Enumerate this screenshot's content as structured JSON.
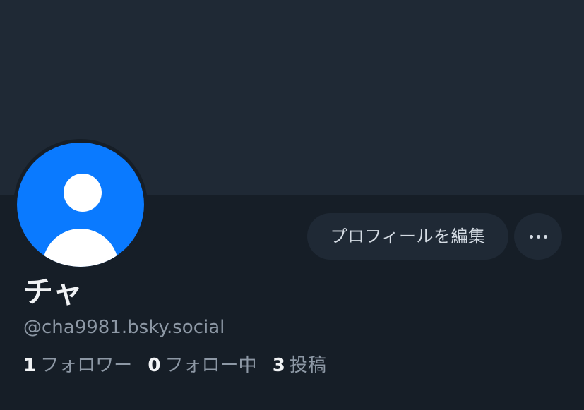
{
  "profile": {
    "display_name": "チャ",
    "handle": "@cha9981.bsky.social",
    "avatar_icon": "default-user-avatar-icon",
    "avatar_color": "#0a7aff",
    "banner_color": "#1f2935"
  },
  "actions": {
    "edit_profile_label": "プロフィールを編集",
    "more_icon": "ellipsis-icon"
  },
  "stats": {
    "followers_count": "1",
    "followers_label": "フォロワー",
    "following_count": "0",
    "following_label": "フォロー中",
    "posts_count": "3",
    "posts_label": "投稿"
  }
}
